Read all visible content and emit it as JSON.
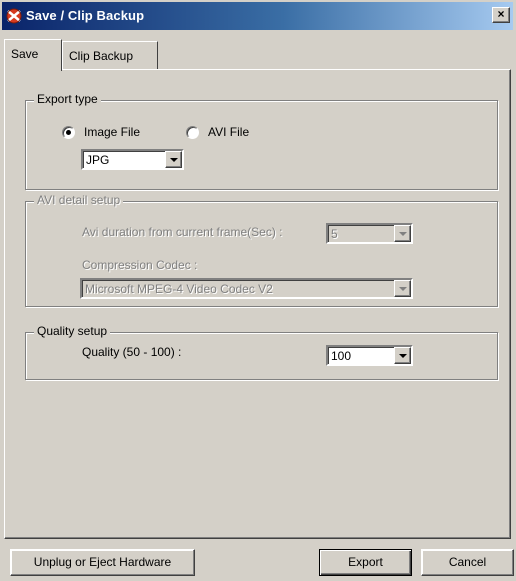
{
  "window": {
    "title": "Save / Clip Backup",
    "close_label": "×"
  },
  "tabs": [
    {
      "label": "Save",
      "active": true
    },
    {
      "label": "Clip Backup",
      "active": false
    }
  ],
  "export_type": {
    "legend": "Export type",
    "radio_image": {
      "label": "Image File",
      "checked": true
    },
    "radio_avi": {
      "label": "AVI File",
      "checked": false
    },
    "format": {
      "value": "JPG"
    }
  },
  "avi_setup": {
    "legend": "AVI detail setup",
    "duration_label": "Avi duration from current frame(Sec) :",
    "duration_value": "5",
    "codec_label": "Compression Codec :",
    "codec_value": "Microsoft MPEG-4 Video Codec V2"
  },
  "quality": {
    "legend": "Quality setup",
    "label": "Quality (50 - 100) :",
    "value": "100"
  },
  "buttons": {
    "eject": "Unplug or Eject Hardware",
    "export": "Export",
    "cancel": "Cancel"
  },
  "colors": {
    "title_bar_start": "#0a246a",
    "title_bar_end": "#a6caf0",
    "face": "#d4d0c8"
  }
}
